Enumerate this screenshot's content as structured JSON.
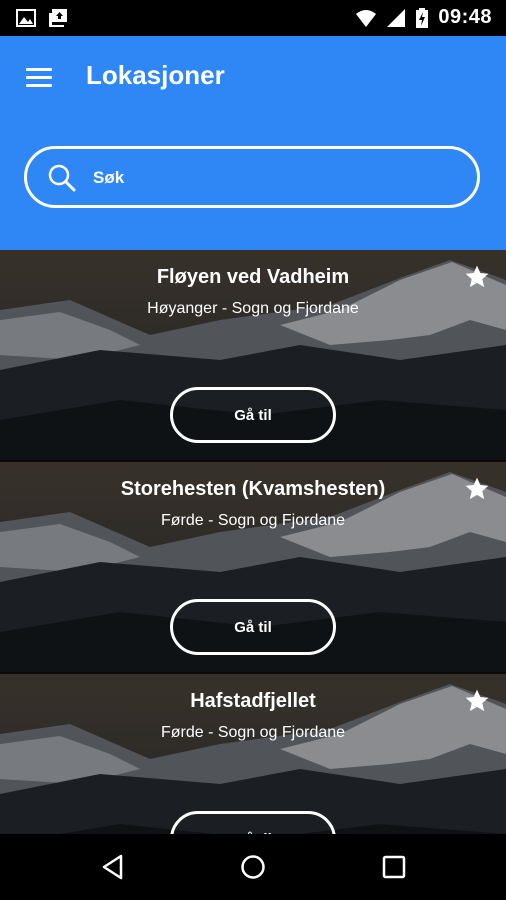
{
  "status_bar": {
    "time": "09:48"
  },
  "app_bar": {
    "title": "Lokasjoner",
    "search_placeholder": "Søk"
  },
  "locations": [
    {
      "title": "Fløyen ved Vadheim",
      "subtitle": "Høyanger - Sogn og Fjordane",
      "button": "Gå til",
      "favorite": true
    },
    {
      "title": "Storehesten (Kvamshesten)",
      "subtitle": "Førde - Sogn og Fjordane",
      "button": "Gå til",
      "favorite": true
    },
    {
      "title": "Hafstadfjellet",
      "subtitle": "Førde - Sogn og Fjordane",
      "button": "Gå til",
      "favorite": true
    }
  ],
  "colors": {
    "app_bar": "#2f87f5",
    "text": "#ffffff"
  },
  "icons": [
    "image-icon",
    "photo-upload-icon",
    "wifi-icon",
    "signal-icon",
    "battery-charging-icon",
    "menu-icon",
    "search-icon",
    "star-icon",
    "back-icon",
    "home-icon",
    "recents-icon"
  ]
}
